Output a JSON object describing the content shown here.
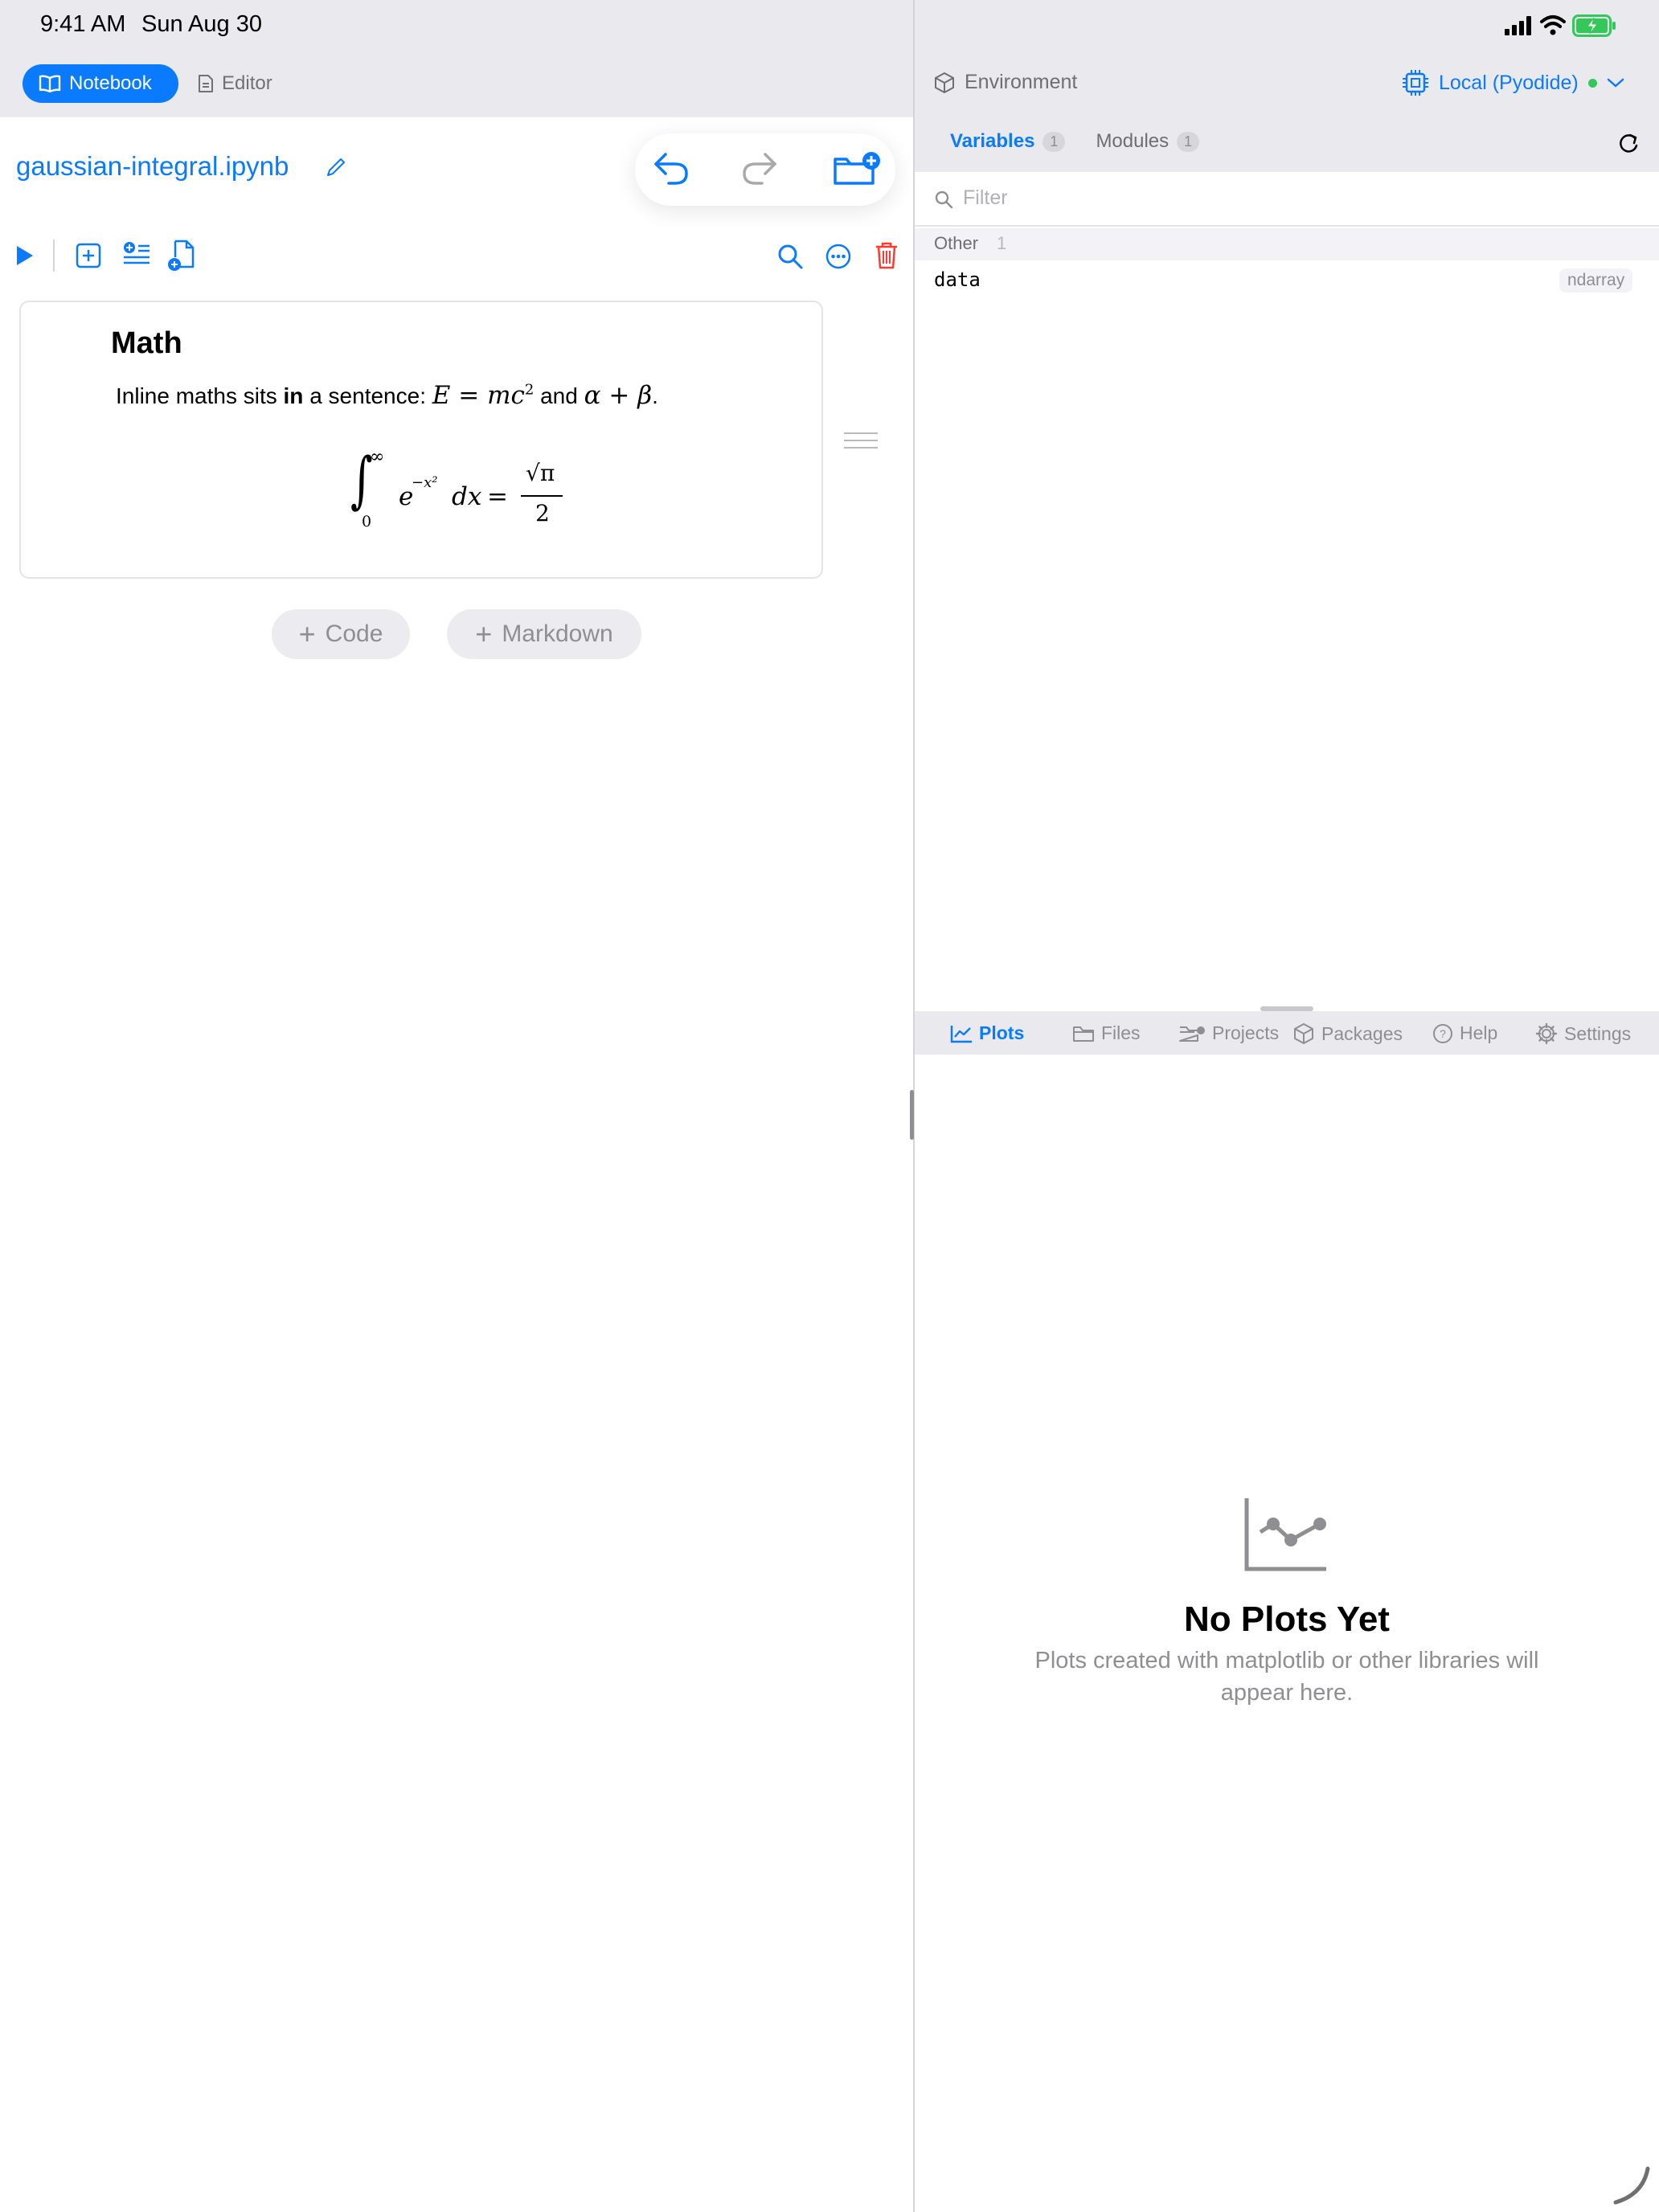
{
  "status_bar": {
    "time": "9:41 AM",
    "date": "Sun Aug 30"
  },
  "left_header": {
    "tabs": [
      {
        "label": "Notebook",
        "active": true
      },
      {
        "label": "Editor",
        "active": false
      }
    ]
  },
  "notebook": {
    "filename": "gaussian-integral.ipynb",
    "cell": {
      "heading": "Math",
      "sentence_prefix": "Inline maths sits ",
      "sentence_bold": "in",
      "sentence_mid": " a sentence: ",
      "inline_eq1": "E = mc²",
      "conjunction": " and ",
      "inline_eq2": "α + β",
      "period": ".",
      "display_eq": "∫₀^∞ e^(−x²) dx = √π / 2"
    },
    "add_code_label": "Code",
    "add_markdown_label": "Markdown"
  },
  "environment": {
    "title": "Environment",
    "kernel": "Local (Pyodide)",
    "kernel_status_color": "#34c759",
    "tabs": [
      {
        "label": "Variables",
        "count": "1",
        "active": true
      },
      {
        "label": "Modules",
        "count": "1",
        "active": false
      }
    ],
    "filter_placeholder": "Filter",
    "group": {
      "name": "Other",
      "count": "1"
    },
    "variables": [
      {
        "name": "data",
        "type": "ndarray"
      }
    ]
  },
  "bottom_tabs": [
    {
      "label": "Plots",
      "icon": "chart-icon",
      "active": true
    },
    {
      "label": "Files",
      "icon": "folder-icon",
      "active": false
    },
    {
      "label": "Projects",
      "icon": "folder-badge-icon",
      "active": false
    },
    {
      "label": "Packages",
      "icon": "cube-icon",
      "active": false
    },
    {
      "label": "Help",
      "icon": "question-icon",
      "active": false
    },
    {
      "label": "Settings",
      "icon": "gear-icon",
      "active": false
    }
  ],
  "plots_empty": {
    "title": "No Plots Yet",
    "subtitle": "Plots created with matplotlib or other libraries will appear here."
  },
  "colors": {
    "accent": "#0a7aff",
    "danger": "#ff3b30",
    "muted": "#8e8e93"
  }
}
